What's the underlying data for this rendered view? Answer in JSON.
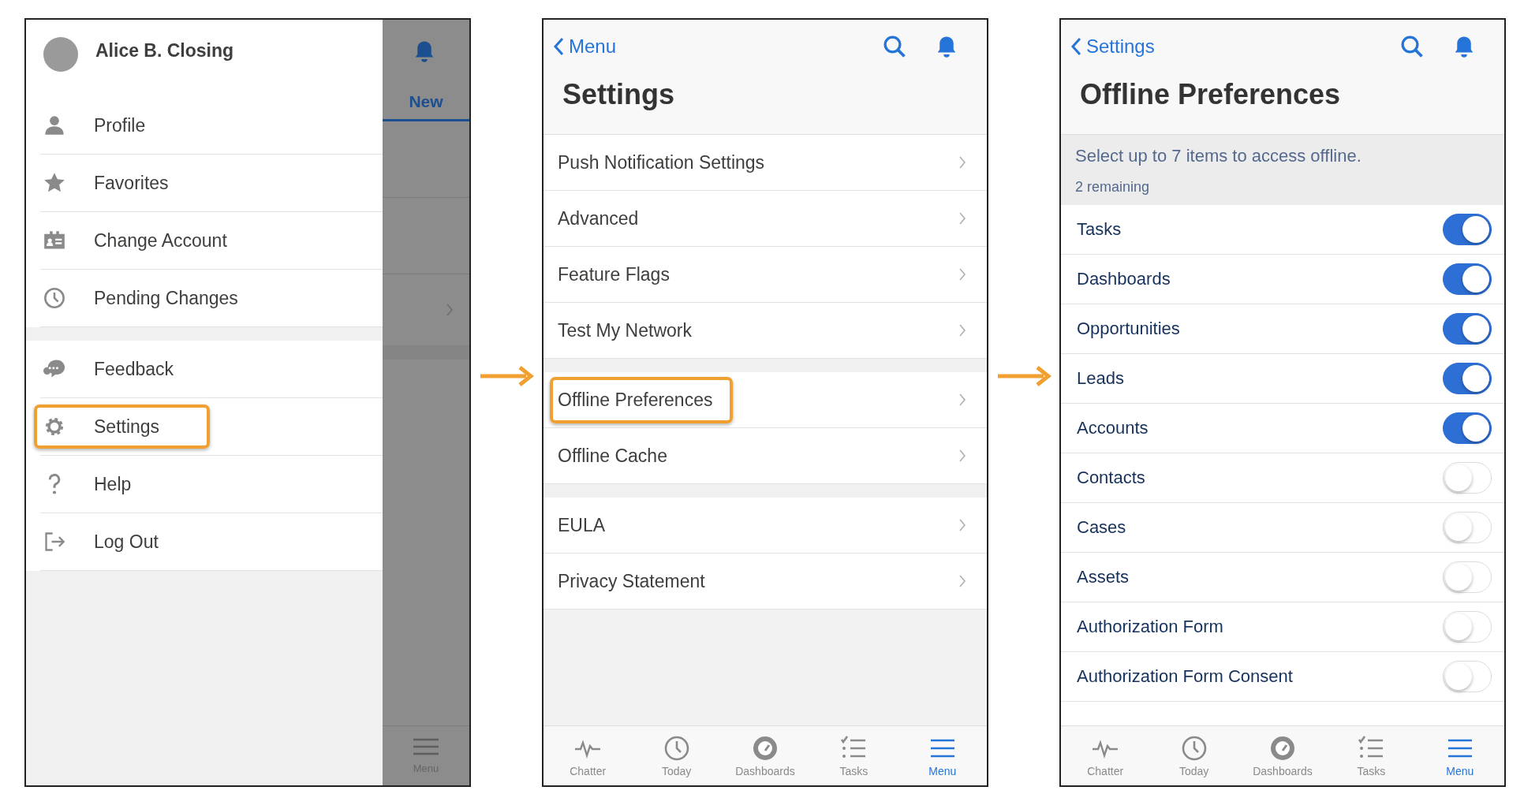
{
  "drawer_screen": {
    "user": {
      "name": "Alice B. Closing"
    },
    "groups": [
      [
        {
          "label": "Profile",
          "highlighted": false
        },
        {
          "label": "Favorites",
          "highlighted": false
        },
        {
          "label": "Change Account",
          "highlighted": false
        },
        {
          "label": "Pending Changes",
          "highlighted": false
        }
      ],
      [
        {
          "label": "Feedback",
          "highlighted": false
        },
        {
          "label": "Settings",
          "highlighted": true
        },
        {
          "label": "Help",
          "highlighted": false
        },
        {
          "label": "Log Out",
          "highlighted": false
        }
      ]
    ],
    "background": {
      "tab_label": "New",
      "bottom_tab_label": "Menu"
    }
  },
  "settings_screen": {
    "back_label": "Menu",
    "title": "Settings",
    "groups": [
      [
        {
          "label": "Push Notification Settings",
          "highlighted": false
        },
        {
          "label": "Advanced",
          "highlighted": false
        },
        {
          "label": "Feature Flags",
          "highlighted": false
        },
        {
          "label": "Test My Network",
          "highlighted": false
        }
      ],
      [
        {
          "label": "Offline Preferences",
          "highlighted": true
        },
        {
          "label": "Offline Cache",
          "highlighted": false
        }
      ],
      [
        {
          "label": "EULA",
          "highlighted": false
        },
        {
          "label": "Privacy Statement",
          "highlighted": false
        }
      ]
    ],
    "tabs": [
      {
        "label": "Chatter",
        "selected": false
      },
      {
        "label": "Today",
        "selected": false
      },
      {
        "label": "Dashboards",
        "selected": false
      },
      {
        "label": "Tasks",
        "selected": false
      },
      {
        "label": "Menu",
        "selected": true
      }
    ]
  },
  "offline_screen": {
    "back_label": "Settings",
    "title": "Offline Preferences",
    "instruction": "Select up to 7 items to access offline.",
    "remaining": "2 remaining",
    "items": [
      {
        "label": "Tasks",
        "on": true
      },
      {
        "label": "Dashboards",
        "on": true
      },
      {
        "label": "Opportunities",
        "on": true
      },
      {
        "label": "Leads",
        "on": true
      },
      {
        "label": "Accounts",
        "on": true
      },
      {
        "label": "Contacts",
        "on": false
      },
      {
        "label": "Cases",
        "on": false
      },
      {
        "label": "Assets",
        "on": false
      },
      {
        "label": "Authorization Form",
        "on": false
      },
      {
        "label": "Authorization Form Consent",
        "on": false
      }
    ],
    "tabs": [
      {
        "label": "Chatter",
        "selected": false
      },
      {
        "label": "Today",
        "selected": false
      },
      {
        "label": "Dashboards",
        "selected": false
      },
      {
        "label": "Tasks",
        "selected": false
      },
      {
        "label": "Menu",
        "selected": true
      }
    ]
  }
}
